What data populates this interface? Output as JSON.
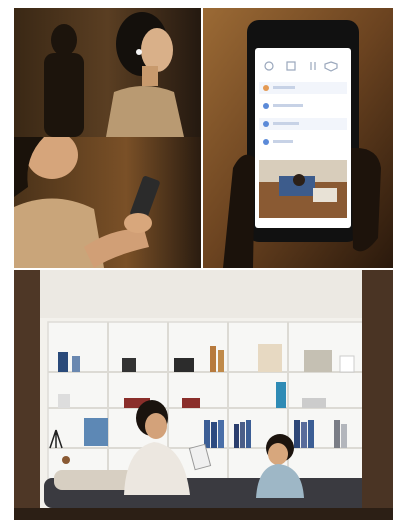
{
  "photos": [
    {
      "name": "woman-profile-earbud-photo",
      "scene": "woman-earbud"
    },
    {
      "name": "woman-holding-phone-photo",
      "scene": "woman-phone"
    },
    {
      "name": "hand-holding-phone-app-photo",
      "scene": "hand-phone"
    },
    {
      "name": "family-living-room-photo",
      "scene": "living-room"
    }
  ],
  "phone_app": {
    "icons": [
      "bulb-icon",
      "box-icon",
      "plug-icon",
      "shield-icon"
    ],
    "list_icons": [
      "sun-icon",
      "lamp-icon",
      "tv-icon",
      "camera-icon"
    ]
  },
  "colors": {
    "warm_dark": "#2a1d12",
    "warm_amber": "#8a5a2e",
    "skin": "#c89a6d",
    "shelf_white": "#f1f0ec",
    "wall_brown": "#6e4a2f",
    "screen_bg": "#ffffff",
    "app_accent": "#5b8ad8"
  }
}
